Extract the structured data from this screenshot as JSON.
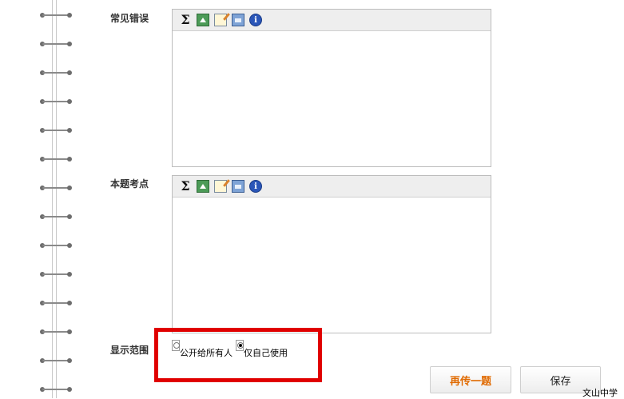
{
  "form": {
    "common_errors_label": "常见错误",
    "key_points_label": "本题考点",
    "visibility_label": "显示范围"
  },
  "toolbar": {
    "sigma_glyph": "Σ",
    "info_glyph": "i",
    "icons": [
      "sigma-icon",
      "upload-image-icon",
      "edit-icon",
      "screen-icon",
      "info-icon"
    ]
  },
  "visibility": {
    "options": [
      {
        "label": "公开给所有人",
        "checked": false
      },
      {
        "label": "仅自己使用",
        "checked": true
      }
    ]
  },
  "actions": {
    "reupload_label": "再传一题",
    "save_label": "保存"
  },
  "watermark": "文山中学",
  "colors": {
    "highlight": "#e00000",
    "primary_text": "#e06a00"
  }
}
